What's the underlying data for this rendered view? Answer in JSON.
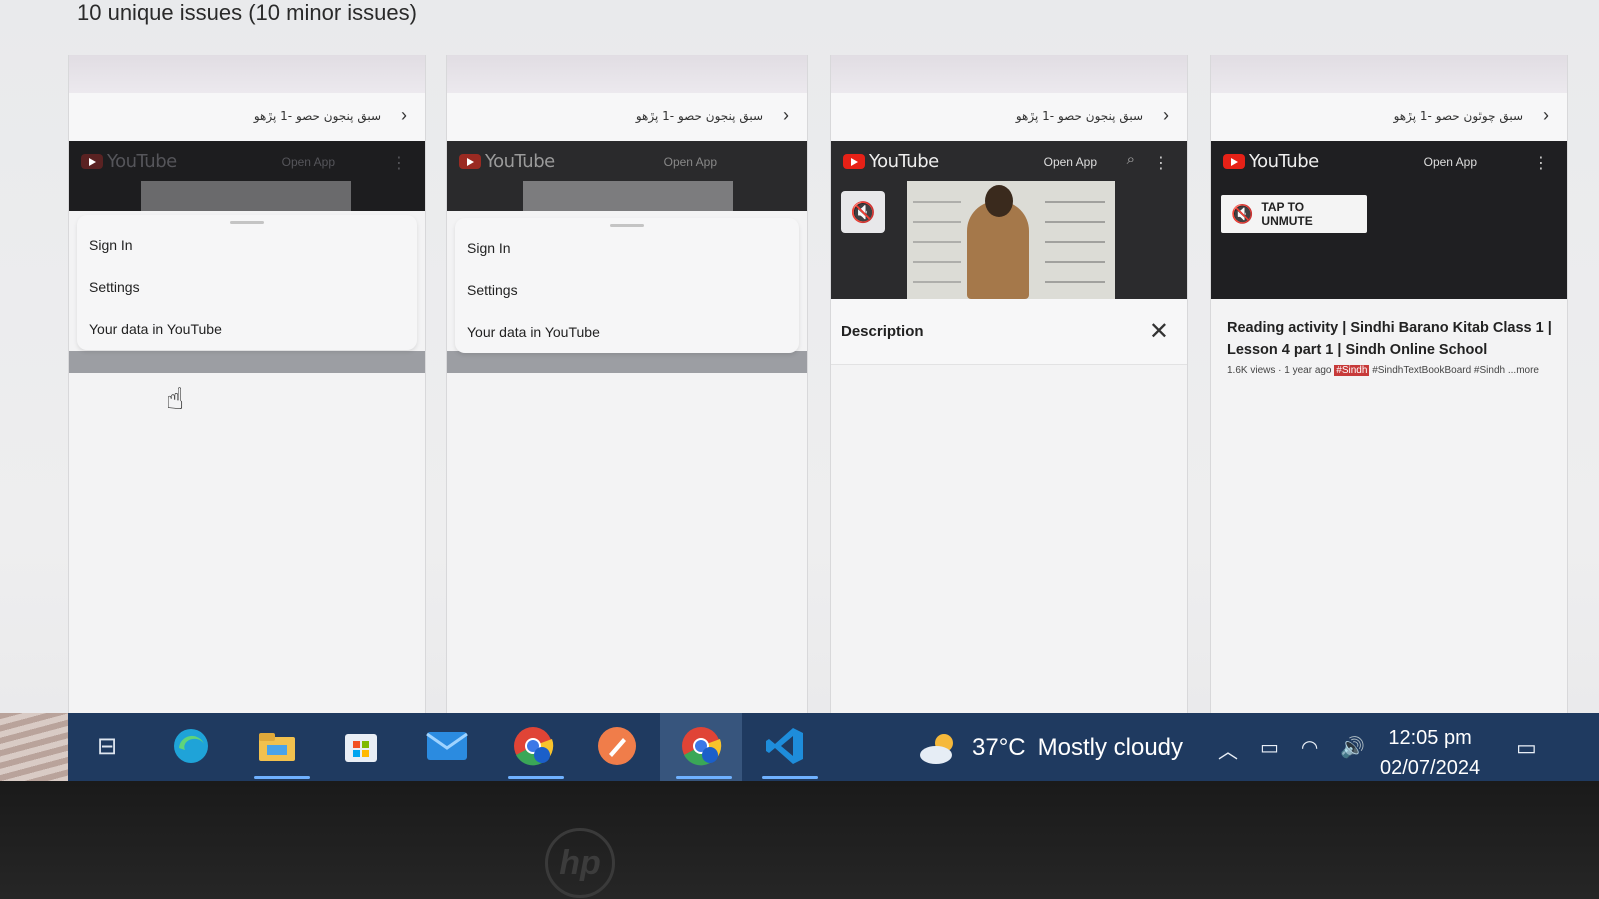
{
  "heading": "10 unique issues (10 minor issues)",
  "cards": [
    {
      "rtl_title": "سبق پنجون حصو -1 پڙهو",
      "youtube": "YouTube",
      "open_app": "Open App",
      "menu": [
        "Sign In",
        "Settings",
        "Your data in YouTube"
      ]
    },
    {
      "rtl_title": "سبق پنجون حصو -1 پڙهو",
      "youtube": "YouTube",
      "open_app": "Open App",
      "menu": [
        "Sign In",
        "Settings",
        "Your data in YouTube"
      ]
    },
    {
      "rtl_title": "سبق پنجون حصو -1 پڙهو",
      "youtube": "YouTube",
      "open_app": "Open App",
      "description": "Description"
    },
    {
      "rtl_title": "سبق چوٿون حصو -1 پڙهو",
      "youtube": "YouTube",
      "open_app": "Open App",
      "unmute": "TAP TO UNMUTE",
      "title": "Reading activity | Sindhi Barano Kitab Class 1 | Lesson 4 part 1 | Sindh Online School",
      "meta": "1.6K views · 1 year ago",
      "meta_tag": "#Sindh",
      "meta_tags": "#SindhTextBookBoard #Sindh",
      "more": "...more"
    }
  ],
  "taskbar": {
    "apps": [
      "task-view",
      "edge",
      "file-explorer",
      "microsoft-store",
      "mail",
      "chrome-profile-i",
      "pencil-app",
      "chrome-profile-d",
      "vscode"
    ],
    "weather": {
      "temp": "37°C",
      "condition": "Mostly cloudy"
    },
    "time": "12:05 pm",
    "date": "02/07/2024"
  },
  "colors": {
    "taskbar": "#1f3a60",
    "youtube_red": "#e62117",
    "accent": "#6fb1ff"
  }
}
